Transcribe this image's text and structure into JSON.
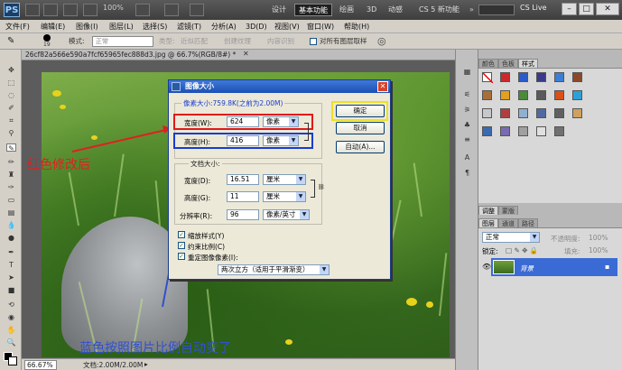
{
  "titlebar": {
    "app_logo": "PS",
    "zoom": "100%",
    "workspaces": [
      "设计",
      "基本功能",
      "绘画",
      "3D",
      "动感",
      "CS 5 新功能"
    ],
    "active_workspace": "基本功能",
    "cs_live": "CS Live"
  },
  "menu": [
    "文件(F)",
    "编辑(E)",
    "图像(I)",
    "图层(L)",
    "选择(S)",
    "滤镜(T)",
    "分析(A)",
    "3D(D)",
    "视图(V)",
    "窗口(W)",
    "帮助(H)"
  ],
  "options": {
    "brush_size": "19",
    "mode_label": "模式:",
    "mode_value": "正常",
    "type_label": "类型:",
    "approx_label": "近似匹配",
    "texture_label": "创建纹理",
    "content_aware_label": "内容识别",
    "all_layers_label": "对所有图层取样"
  },
  "document": {
    "tab_title": "26cf82a566e590a7fcf65965fec888d3.jpg @ 66.7%(RGB/8#) *",
    "zoom": "66.67%",
    "doc_info": "文档:2.00M/2.00M"
  },
  "dialog": {
    "title": "图像大小",
    "pixel_dims_label": "像素大小:759.8K(之前为2.00M)",
    "width_label": "宽度(W):",
    "width_value": "624",
    "width_unit": "像素",
    "height_label": "高度(H):",
    "height_value": "416",
    "height_unit": "像素",
    "doc_size_label": "文档大小:",
    "doc_width_label": "宽度(D):",
    "doc_width_value": "16.51",
    "doc_width_unit": "厘米",
    "doc_height_label": "高度(G):",
    "doc_height_value": "11",
    "doc_height_unit": "厘米",
    "resolution_label": "分辨率(R):",
    "resolution_value": "96",
    "resolution_unit": "像素/英寸",
    "scale_styles": "缩放样式(Y)",
    "constrain": "约束比例(C)",
    "resample": "重定图像像素(I):",
    "resample_method": "两次立方（适用于平滑渐变）",
    "ok": "确定",
    "cancel": "取消",
    "auto": "自动(A)..."
  },
  "panels": {
    "tabs_top": [
      "颜色",
      "色板",
      "样式"
    ],
    "active_top": "样式",
    "tabs_mid": [
      "调整",
      "蒙版"
    ],
    "tabs_layers": [
      "图层",
      "通道",
      "路径"
    ],
    "blend_mode": "正常",
    "opacity_label": "不透明度:",
    "opacity_value": "100%",
    "lock_label": "锁定:",
    "fill_label": "填充:",
    "fill_value": "100%",
    "layer_name": "背景"
  },
  "annotations": {
    "red_note": "红色修改后",
    "blue_note": "蓝色按照图片比例自动变了"
  },
  "watermark": {
    "brand": "Bai du 经验",
    "url": "jingyan.baidu.com"
  },
  "colors": {
    "red_annotation": "#e02020",
    "blue_annotation": "#3050d0",
    "yellow_highlight": "#f0e020",
    "layer_selected": "#3a6ad4"
  }
}
